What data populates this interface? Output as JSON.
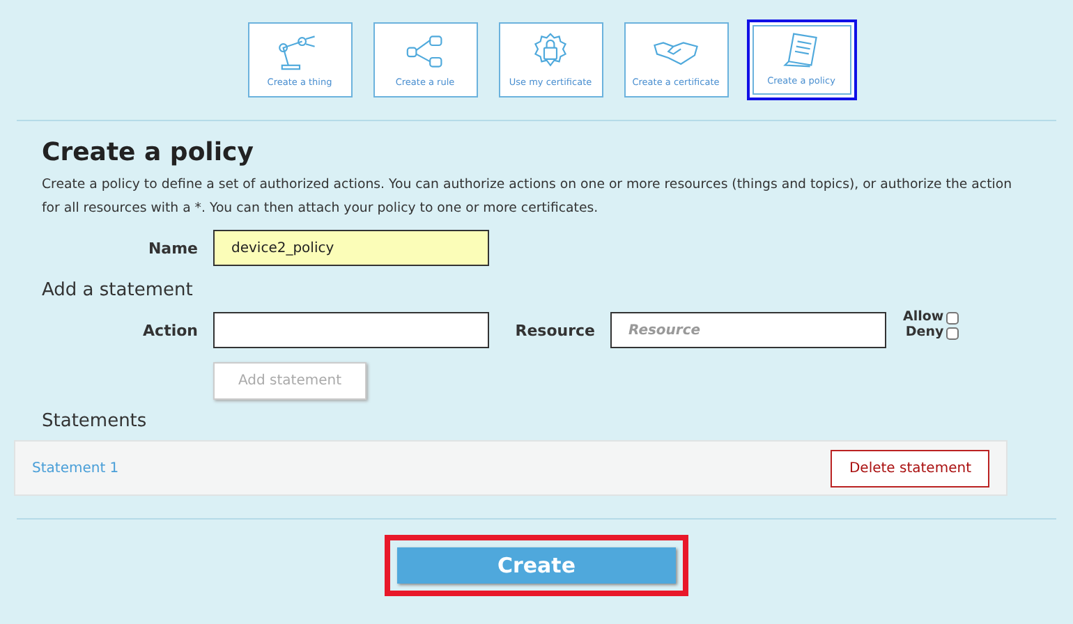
{
  "tiles": [
    {
      "label": "Create a thing",
      "kind": "robot-arm",
      "selected": false
    },
    {
      "label": "Create a rule",
      "kind": "flow",
      "selected": false
    },
    {
      "label": "Use my certificate",
      "kind": "lock-seal",
      "selected": false
    },
    {
      "label": "Create a certificate",
      "kind": "handshake",
      "selected": false
    },
    {
      "label": "Create a policy",
      "kind": "document",
      "selected": true
    }
  ],
  "title": "Create a policy",
  "description": "Create a policy to define a set of authorized actions. You can authorize actions on one or more resources (things and topics), or authorize the action for all resources with a *. You can then attach your policy to one or more certificates.",
  "name_field": {
    "label": "Name",
    "value": "device2_policy"
  },
  "statement_heading": "Add a statement",
  "action_field": {
    "label": "Action"
  },
  "resource_field": {
    "label": "Resource",
    "placeholder": "Resource"
  },
  "effects": [
    {
      "label": "Allow",
      "checked": false
    },
    {
      "label": "Deny",
      "checked": false
    }
  ],
  "add_button": {
    "label": "Add statement",
    "disabled": true
  },
  "statements_heading": "Statements",
  "statements": [
    {
      "name": "Statement 1",
      "delete_label": "Delete statement"
    }
  ],
  "create_button": {
    "label": "Create",
    "highlighted": true
  }
}
